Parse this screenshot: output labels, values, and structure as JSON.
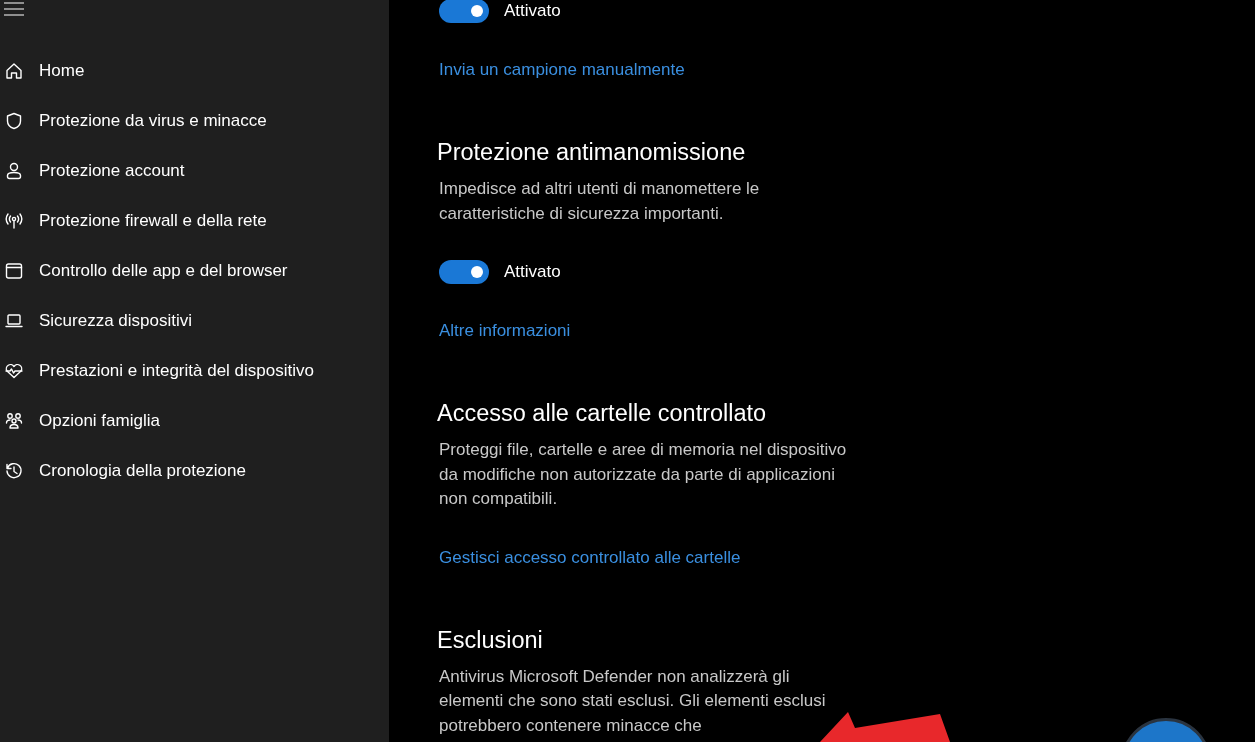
{
  "sidebar": {
    "items": [
      {
        "label": "Home"
      },
      {
        "label": "Protezione da virus e minacce"
      },
      {
        "label": "Protezione account"
      },
      {
        "label": "Protezione firewall e della rete"
      },
      {
        "label": "Controllo delle app e del browser"
      },
      {
        "label": "Sicurezza dispositivi"
      },
      {
        "label": "Prestazioni e integrità del dispositivo"
      },
      {
        "label": "Opzioni famiglia"
      },
      {
        "label": "Cronologia della protezione"
      }
    ]
  },
  "sections": [
    {
      "toggle": {
        "on": true,
        "label": "Attivato"
      },
      "link": "Invia un campione manualmente"
    },
    {
      "title": "Protezione antimanomissione",
      "description": "Impedisce ad altri utenti di manomettere le caratteristiche di sicurezza importanti.",
      "toggle": {
        "on": true,
        "label": "Attivato"
      },
      "link": "Altre informazioni"
    },
    {
      "title": "Accesso alle cartelle controllato",
      "description": "Proteggi file, cartelle e aree di memoria nel dispositivo da modifiche non autorizzate da parte di applicazioni non compatibili.",
      "link": "Gestisci accesso controllato alle cartelle"
    },
    {
      "title": "Esclusioni",
      "description": "Antivirus Microsoft Defender non analizzerà gli elementi che sono stati esclusi. Gli elementi esclusi potrebbero contenere minacce che"
    }
  ]
}
